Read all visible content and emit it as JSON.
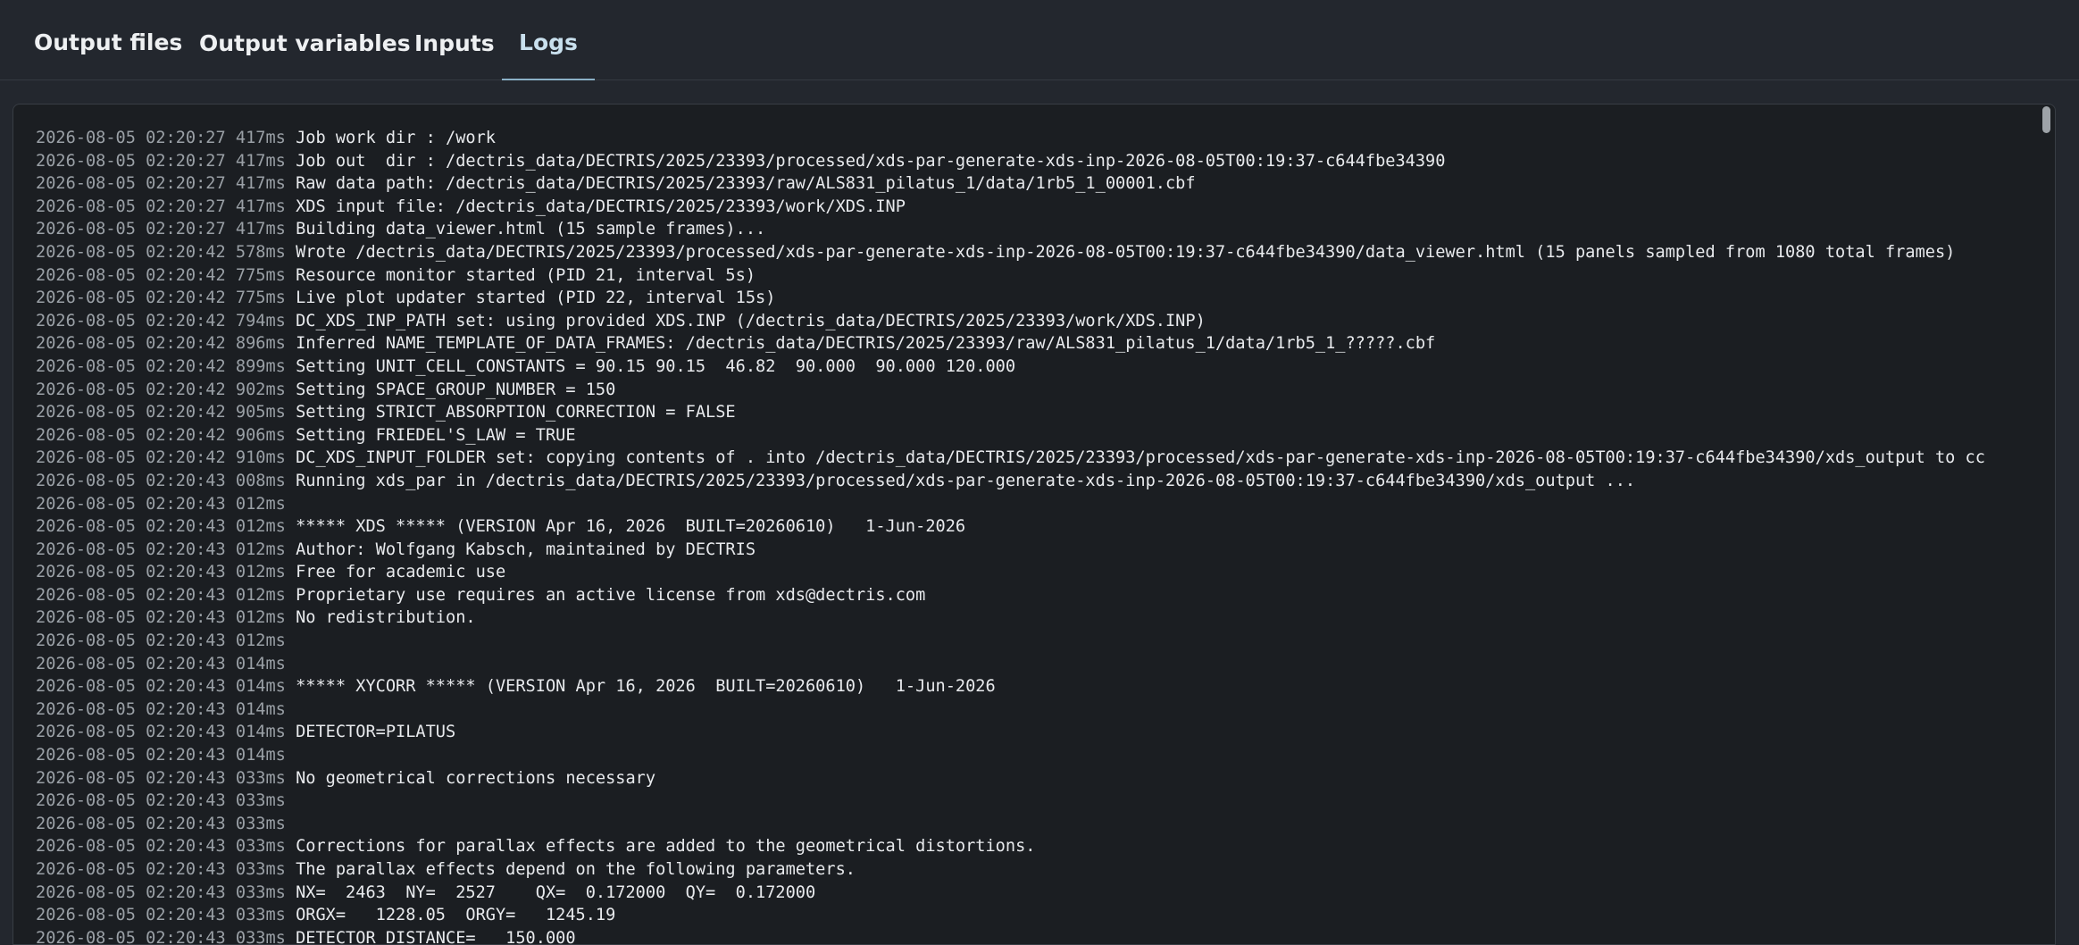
{
  "tabs": [
    {
      "label": "Output files",
      "active": false
    },
    {
      "label": "Output variables",
      "active": false
    },
    {
      "label": "Inputs",
      "active": false
    },
    {
      "label": "Logs",
      "active": true
    }
  ],
  "colors": {
    "background": "#23272e",
    "panel": "#1b1e22",
    "active_tab": "#c9e0ee",
    "timestamp": "#9aa0a6",
    "message": "#e8eaed"
  },
  "logs": [
    {
      "ts": "2026-08-05 02:20:27 417ms",
      "msg": "Job work dir : /work"
    },
    {
      "ts": "2026-08-05 02:20:27 417ms",
      "msg": "Job out  dir : /dectris_data/DECTRIS/2025/23393/processed/xds-par-generate-xds-inp-2026-08-05T00:19:37-c644fbe34390"
    },
    {
      "ts": "2026-08-05 02:20:27 417ms",
      "msg": "Raw data path: /dectris_data/DECTRIS/2025/23393/raw/ALS831_pilatus_1/data/1rb5_1_00001.cbf"
    },
    {
      "ts": "2026-08-05 02:20:27 417ms",
      "msg": "XDS input file: /dectris_data/DECTRIS/2025/23393/work/XDS.INP"
    },
    {
      "ts": "2026-08-05 02:20:27 417ms",
      "msg": "Building data_viewer.html (15 sample frames)..."
    },
    {
      "ts": "2026-08-05 02:20:42 578ms",
      "msg": "Wrote /dectris_data/DECTRIS/2025/23393/processed/xds-par-generate-xds-inp-2026-08-05T00:19:37-c644fbe34390/data_viewer.html (15 panels sampled from 1080 total frames)"
    },
    {
      "ts": "2026-08-05 02:20:42 775ms",
      "msg": "Resource monitor started (PID 21, interval 5s)"
    },
    {
      "ts": "2026-08-05 02:20:42 775ms",
      "msg": "Live plot updater started (PID 22, interval 15s)"
    },
    {
      "ts": "2026-08-05 02:20:42 794ms",
      "msg": "DC_XDS_INP_PATH set: using provided XDS.INP (/dectris_data/DECTRIS/2025/23393/work/XDS.INP)"
    },
    {
      "ts": "2026-08-05 02:20:42 896ms",
      "msg": "Inferred NAME_TEMPLATE_OF_DATA_FRAMES: /dectris_data/DECTRIS/2025/23393/raw/ALS831_pilatus_1/data/1rb5_1_?????.cbf"
    },
    {
      "ts": "2026-08-05 02:20:42 899ms",
      "msg": "Setting UNIT_CELL_CONSTANTS = 90.15 90.15  46.82  90.000  90.000 120.000"
    },
    {
      "ts": "2026-08-05 02:20:42 902ms",
      "msg": "Setting SPACE_GROUP_NUMBER = 150"
    },
    {
      "ts": "2026-08-05 02:20:42 905ms",
      "msg": "Setting STRICT_ABSORPTION_CORRECTION = FALSE"
    },
    {
      "ts": "2026-08-05 02:20:42 906ms",
      "msg": "Setting FRIEDEL'S_LAW = TRUE"
    },
    {
      "ts": "2026-08-05 02:20:42 910ms",
      "msg": "DC_XDS_INPUT_FOLDER set: copying contents of . into /dectris_data/DECTRIS/2025/23393/processed/xds-par-generate-xds-inp-2026-08-05T00:19:37-c644fbe34390/xds_output to cc"
    },
    {
      "ts": "2026-08-05 02:20:43 008ms",
      "msg": "Running xds_par in /dectris_data/DECTRIS/2025/23393/processed/xds-par-generate-xds-inp-2026-08-05T00:19:37-c644fbe34390/xds_output ..."
    },
    {
      "ts": "2026-08-05 02:20:43 012ms",
      "msg": ""
    },
    {
      "ts": "2026-08-05 02:20:43 012ms",
      "msg": "***** XDS ***** (VERSION Apr 16, 2026  BUILT=20260610)   1-Jun-2026"
    },
    {
      "ts": "2026-08-05 02:20:43 012ms",
      "msg": "Author: Wolfgang Kabsch, maintained by DECTRIS"
    },
    {
      "ts": "2026-08-05 02:20:43 012ms",
      "msg": "Free for academic use"
    },
    {
      "ts": "2026-08-05 02:20:43 012ms",
      "msg": "Proprietary use requires an active license from xds@dectris.com"
    },
    {
      "ts": "2026-08-05 02:20:43 012ms",
      "msg": "No redistribution."
    },
    {
      "ts": "2026-08-05 02:20:43 012ms",
      "msg": ""
    },
    {
      "ts": "2026-08-05 02:20:43 014ms",
      "msg": ""
    },
    {
      "ts": "2026-08-05 02:20:43 014ms",
      "msg": "***** XYCORR ***** (VERSION Apr 16, 2026  BUILT=20260610)   1-Jun-2026"
    },
    {
      "ts": "2026-08-05 02:20:43 014ms",
      "msg": ""
    },
    {
      "ts": "2026-08-05 02:20:43 014ms",
      "msg": "DETECTOR=PILATUS"
    },
    {
      "ts": "2026-08-05 02:20:43 014ms",
      "msg": ""
    },
    {
      "ts": "2026-08-05 02:20:43 033ms",
      "msg": "No geometrical corrections necessary"
    },
    {
      "ts": "2026-08-05 02:20:43 033ms",
      "msg": ""
    },
    {
      "ts": "2026-08-05 02:20:43 033ms",
      "msg": ""
    },
    {
      "ts": "2026-08-05 02:20:43 033ms",
      "msg": "Corrections for parallax effects are added to the geometrical distortions."
    },
    {
      "ts": "2026-08-05 02:20:43 033ms",
      "msg": "The parallax effects depend on the following parameters."
    },
    {
      "ts": "2026-08-05 02:20:43 033ms",
      "msg": "NX=  2463  NY=  2527    QX=  0.172000  QY=  0.172000"
    },
    {
      "ts": "2026-08-05 02:20:43 033ms",
      "msg": "ORGX=   1228.05  ORGY=   1245.19"
    },
    {
      "ts": "2026-08-05 02:20:43 033ms",
      "msg": "DETECTOR_DISTANCE=   150.000"
    }
  ]
}
